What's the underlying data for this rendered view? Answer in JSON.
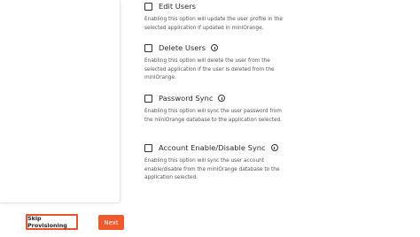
{
  "options": [
    {
      "label": "Edit Users",
      "has_info": false,
      "description": "Enabling this option will update the user profile in the selected application if updated in miniOrange."
    },
    {
      "label": "Delete Users",
      "has_info": true,
      "description": "Enabling this option will delete the user from the selected application if the user is deleted from the miniOrange."
    },
    {
      "label": "Password Sync",
      "has_info": true,
      "description": "Enabling this option will sync the user password from the miniOrange database to the application selected."
    },
    {
      "label": "Account Enable/Disable Sync",
      "has_info": true,
      "description": "Enabling this option will sync the user account enable/disable from the miniOrange database to the application selected."
    }
  ],
  "footer": {
    "skip_label": "Skip Provisioning",
    "next_label": "Next"
  },
  "colors": {
    "accent": "#f0592b",
    "skip_border": "#e8552b"
  },
  "icons": {
    "checkbox": "checkbox-unchecked",
    "info": "info-circle-icon"
  }
}
